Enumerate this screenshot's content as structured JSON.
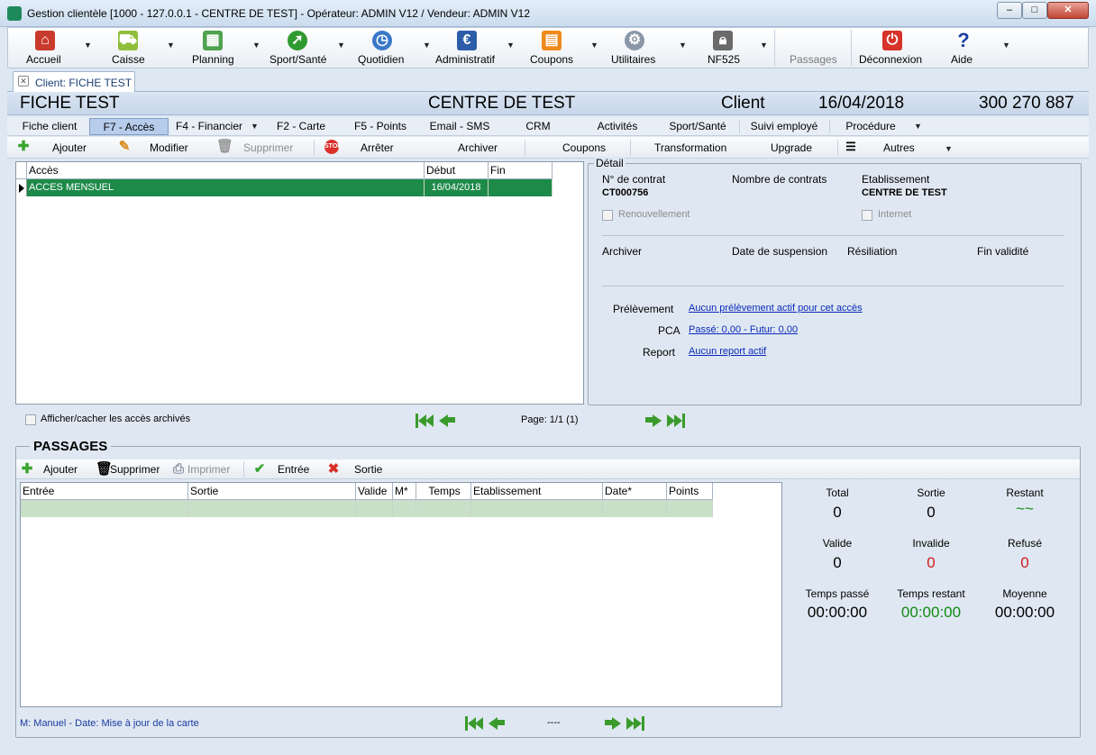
{
  "window": {
    "title": "Gestion clientèle [1000 - 127.0.0.1 - CENTRE DE TEST] - Opérateur: ADMIN V12 / Vendeur: ADMIN V12"
  },
  "toolbar": {
    "items": [
      {
        "label": "Accueil",
        "icon": "home-icon"
      },
      {
        "label": "Caisse",
        "icon": "cart-icon"
      },
      {
        "label": "Planning",
        "icon": "calendar-icon"
      },
      {
        "label": "Sport/Santé",
        "icon": "runner-icon"
      },
      {
        "label": "Quotidien",
        "icon": "clock-icon"
      },
      {
        "label": "Administratif",
        "icon": "euro-icon"
      },
      {
        "label": "Coupons",
        "icon": "ticket-icon"
      },
      {
        "label": "Utilitaires",
        "icon": "gear-icon"
      },
      {
        "label": "NF525",
        "icon": "lock-icon"
      },
      {
        "label": "Passages"
      },
      {
        "label": "Déconnexion",
        "icon": "power-icon"
      },
      {
        "label": "Aide",
        "icon": "help-icon"
      }
    ]
  },
  "tabs": {
    "client_tab": "Client: FICHE TEST"
  },
  "header": {
    "name": "FICHE TEST",
    "center": "CENTRE DE TEST",
    "type": "Client",
    "date": "16/04/2018",
    "phone": "300 270 887"
  },
  "subtabs": [
    "Fiche client",
    "F7 - Accès",
    "F4 - Financier",
    "F2 - Carte",
    "F5 - Points",
    "Email - SMS",
    "CRM",
    "Activités",
    "Sport/Santé",
    "Suivi employé",
    "Procédure"
  ],
  "actions": {
    "ajouter": "Ajouter",
    "modifier": "Modifier",
    "supprimer": "Supprimer",
    "arreter": "Arrêter",
    "archiver": "Archiver",
    "coupons": "Coupons",
    "transformation": "Transformation",
    "upgrade": "Upgrade",
    "autres": "Autres"
  },
  "acces_table": {
    "headers": [
      "Accès",
      "Début",
      "Fin"
    ],
    "rows": [
      {
        "acces": "ACCES MENSUEL",
        "debut": "16/04/2018",
        "fin": ""
      }
    ]
  },
  "acces_footer": {
    "show_archived": "Afficher/cacher les accès archivés",
    "page": "Page: 1/1 (1)"
  },
  "detail": {
    "legend": "Détail",
    "contrat_label": "N° de contrat",
    "contrat_value": "CT000756",
    "nb_contrats_label": "Nombre de contrats",
    "etablissement_label": "Etablissement",
    "etablissement_value": "CENTRE DE TEST",
    "renouvellement": "Renouvellement",
    "internet": "Internet",
    "archiver": "Archiver",
    "suspension": "Date de suspension",
    "resiliation": "Résiliation",
    "fin_validite": "Fin validité",
    "prelevement_label": "Prélèvement",
    "prelevement_link": "Aucun prélèvement actif pour cet accès",
    "pca_label": "PCA",
    "pca_link": "Passé: 0,00 - Futur: 0,00",
    "report_label": "Report",
    "report_link": "Aucun report actif"
  },
  "passages": {
    "title": "PASSAGES",
    "ajouter": "Ajouter",
    "supprimer": "Supprimer",
    "imprimer": "Imprimer",
    "entree": "Entrée",
    "sortie": "Sortie",
    "headers": [
      "Entrée",
      "Sortie",
      "Valide",
      "M*",
      "Temps",
      "Etablissement",
      "Date*",
      "Points"
    ],
    "legend": "M: Manuel - Date: Mise à jour de la carte",
    "page": "----"
  },
  "stats": {
    "total_label": "Total",
    "total": "0",
    "sortie_label": "Sortie",
    "sortie": "0",
    "restant_label": "Restant",
    "restant": "~~",
    "valide_label": "Valide",
    "valide": "0",
    "invalide_label": "Invalide",
    "invalide": "0",
    "refuse_label": "Refusé",
    "refuse": "0",
    "temps_passe_label": "Temps passé",
    "temps_passe": "00:00:00",
    "temps_restant_label": "Temps restant",
    "temps_restant": "00:00:00",
    "moyenne_label": "Moyenne",
    "moyenne": "00:00:00"
  },
  "colors": {
    "selected_row": "#1e8a4a",
    "empty_row": "#c8e0c8",
    "green_value": "#118a11",
    "red_value": "#d11c1c",
    "link": "#0b28b8"
  }
}
